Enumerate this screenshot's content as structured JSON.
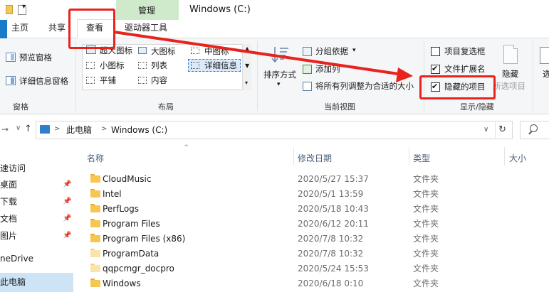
{
  "title_bar": {
    "manage_tab": "管理",
    "window_title": "Windows (C:)"
  },
  "tabs": {
    "home": "主页",
    "share": "共享",
    "view": "查看",
    "drive_tools": "驱动器工具"
  },
  "ribbon": {
    "pane": {
      "preview": "预览窗格",
      "details": "详细信息窗格",
      "group": "窗格"
    },
    "layout": {
      "extra_large": "超大图标",
      "large": "大图标",
      "medium": "中图标",
      "small": "小图标",
      "list": "列表",
      "details": "详细信息",
      "tiles": "平铺",
      "content": "内容",
      "group": "布局"
    },
    "current_view": {
      "sort_by": "排序方式",
      "group_by": "分组依据",
      "add_column": "添加列",
      "size_all_columns": "将所有列调整为合适的大小",
      "group": "当前视图"
    },
    "show_hide": {
      "item_checkboxes": "项目复选框",
      "item_checkboxes_checked": false,
      "file_extensions": "文件扩展名",
      "file_extensions_checked": true,
      "hidden_items": "隐藏的项目",
      "hidden_items_checked": true,
      "hide": "隐藏",
      "selected_items": "所选项目",
      "group": "显示/隐藏",
      "options_partial": "选"
    }
  },
  "address": {
    "root": "此电脑",
    "current": "Windows (C:)",
    "separator": ">"
  },
  "nav": {
    "quick_access": "速访问",
    "desktop": "桌面",
    "downloads": "下载",
    "documents": "文档",
    "pictures": "图片",
    "onedrive": "neDrive",
    "this_pc": "此电脑"
  },
  "columns": {
    "name": "名称",
    "date": "修改日期",
    "type": "类型",
    "size": "大小"
  },
  "files": [
    {
      "name": "CloudMusic",
      "date": "2020/5/27 15:37",
      "type": "文件夹",
      "hidden": false
    },
    {
      "name": "Intel",
      "date": "2020/5/1 13:59",
      "type": "文件夹",
      "hidden": false
    },
    {
      "name": "PerfLogs",
      "date": "2020/5/18 10:43",
      "type": "文件夹",
      "hidden": false
    },
    {
      "name": "Program Files",
      "date": "2020/6/12 20:11",
      "type": "文件夹",
      "hidden": false
    },
    {
      "name": "Program Files (x86)",
      "date": "2020/7/8 10:32",
      "type": "文件夹",
      "hidden": false
    },
    {
      "name": "ProgramData",
      "date": "2020/7/8 10:32",
      "type": "文件夹",
      "hidden": true
    },
    {
      "name": "qqpcmgr_docpro",
      "date": "2020/5/24 15:53",
      "type": "文件夹",
      "hidden": true
    },
    {
      "name": "Windows",
      "date": "2020/6/18 0:10",
      "type": "文件夹",
      "hidden": false
    }
  ],
  "colors": {
    "annotation_red": "#e8231e",
    "manage_green": "#cfeacb",
    "selection_blue": "#cde4f7",
    "folder_yellow": "#f7c652"
  }
}
